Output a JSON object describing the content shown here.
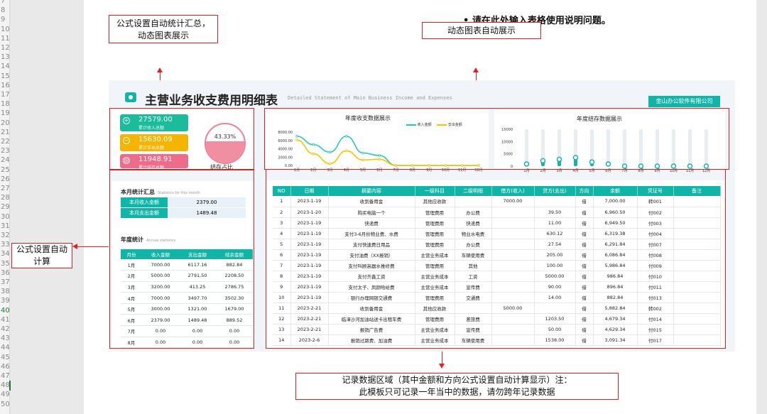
{
  "row_gutter": {
    "labels": [
      "7",
      "8",
      "9",
      "10",
      "11",
      "12",
      "13",
      "14",
      "15",
      "16",
      "17",
      "18",
      "19",
      "20",
      "21",
      "22",
      "23",
      "24",
      "25",
      "26",
      "27",
      "28",
      "29",
      "30",
      "31",
      "32",
      "33",
      "34",
      "35",
      "36",
      "37",
      "38",
      "39",
      "40",
      "41",
      "42",
      "43",
      "44",
      "45",
      "46",
      "47",
      "48",
      "49",
      "50"
    ],
    "active_label": "40"
  },
  "instruction_note": "•  请在此处输入表格使用说明问题。",
  "callouts": {
    "top_left": "公式设置自动统计汇总，动态图表展示",
    "top_right": "动态图表自动展示",
    "left": "公式设置自动计算",
    "bottom": "记录数据区域（其中金额和方向公式设置自动计算显示）注：此模板只可记录一年当中的数据，请勿跨年记录数据"
  },
  "dashboard": {
    "title": "主营业务收支费用明细表",
    "subtitle": "Detailed Statement of Main Business Income and Expenses",
    "company": "金山办公软件有限公司",
    "kpis": [
      {
        "value": "27579.00",
        "label": "累计收入总额",
        "color": "#1abc9c",
        "icon": "+"
      },
      {
        "value": "15630.09",
        "label": "累计支出总额",
        "color": "#f5b400",
        "icon": "−"
      },
      {
        "value": "11948.91",
        "label": "累计结存总额",
        "color": "#ee6c8a",
        "icon": "◎"
      }
    ],
    "balance_ratio": {
      "percent": "43.33%",
      "label": "结存占比",
      "fill_fraction": 0.55
    },
    "monthly": {
      "title": "本月统计汇总",
      "subtitle": "Statistics for this month",
      "rows": [
        {
          "key": "本月收入金额",
          "value": "2379.00"
        },
        {
          "key": "本月支出金额",
          "value": "1489.48"
        }
      ]
    },
    "annual": {
      "title": "年度统计",
      "subtitle": "Annual statistics",
      "headers": [
        "月份",
        "收入金额",
        "支出金额",
        "结余金额"
      ],
      "rows": [
        [
          "1月",
          "7000.00",
          "6117.16",
          "882.84"
        ],
        [
          "2月",
          "5000.00",
          "2791.50",
          "2208.50"
        ],
        [
          "3月",
          "3200.00",
          "413.25",
          "2786.75"
        ],
        [
          "4月",
          "7000.00",
          "3497.70",
          "3502.30"
        ],
        [
          "5月",
          "3000.00",
          "1321.00",
          "1679.00"
        ],
        [
          "6月",
          "2379.00",
          "1489.48",
          "889.52"
        ],
        [
          "7月",
          "0.00",
          "0.00",
          "0.00"
        ],
        [
          "8月",
          "0.00",
          "0.00",
          "0.00"
        ]
      ]
    },
    "detail_table": {
      "headers": [
        "NO",
        "日期",
        "摘要内容",
        "一级科目",
        "二级明细",
        "借方(收入)",
        "贷方(支出)",
        "方向",
        "余额",
        "凭证号",
        "备注"
      ],
      "rows": [
        [
          "1",
          "2023-1-19",
          "收到备用金",
          "其他应收款",
          "",
          "7000.00",
          "",
          "借",
          "7,000.00",
          "转001",
          ""
        ],
        [
          "2",
          "2023-1-20",
          "购买电脑一个",
          "管理费用",
          "办公费",
          "",
          "39.50",
          "借",
          "6,960.50",
          "付002",
          ""
        ],
        [
          "3",
          "2023-1-19",
          "快递费",
          "管理费用",
          "快递费",
          "",
          "11.00",
          "借",
          "6,949.50",
          "付003",
          ""
        ],
        [
          "4",
          "2023-1-19",
          "支付3-6月份物业费、水费",
          "管理费用",
          "物业水电费",
          "",
          "630.12",
          "借",
          "6,319.38",
          "付004",
          ""
        ],
        [
          "5",
          "2023-1-19",
          "支付快速费日用品",
          "管理费用",
          "办公费",
          "",
          "27.54",
          "借",
          "6,291.84",
          "付007",
          ""
        ],
        [
          "6",
          "2023-1-19",
          "支付油费（XX报销）",
          "主营业务成本",
          "车辆使用费",
          "",
          "205.00",
          "借",
          "6,086.84",
          "付008",
          ""
        ],
        [
          "7",
          "2023-1-19",
          "支付叫顾高器水推修费",
          "管理费用",
          "其他",
          "",
          "100.00",
          "借",
          "5,986.84",
          "付009",
          ""
        ],
        [
          "8",
          "2023-1-19",
          "支付齐鑫工资",
          "主营业务成本",
          "工资",
          "",
          "5000.00",
          "借",
          "986.84",
          "付010",
          ""
        ],
        [
          "9",
          "2023-1-19",
          "支付太子、凤颜哈给费",
          "主营业务成本",
          "宣传费",
          "",
          "90.00",
          "借",
          "896.84",
          "付011",
          ""
        ],
        [
          "10",
          "2023-1-19",
          "银行办理网银交通费",
          "管理费用",
          "交通费",
          "",
          "14.00",
          "借",
          "882.84",
          "付013",
          ""
        ],
        [
          "11",
          "2023-2-21",
          "收到备用金",
          "其他应收款",
          "",
          "5000.00",
          "",
          "借",
          "5,882.84",
          "转002",
          ""
        ],
        [
          "12",
          "2023-2-21",
          "临漳沙河加油站送卡出租车费",
          "管理费用",
          "差旅费",
          "",
          "1203.50",
          "借",
          "4,679.34",
          "付014",
          ""
        ],
        [
          "13",
          "2023-2-21",
          "报销广告费",
          "主营业务成本",
          "宣传费",
          "",
          "50.00",
          "借",
          "4,629.34",
          "付015",
          ""
        ],
        [
          "14",
          "2023-2-6",
          "报销过路费、加油费",
          "主营业务成本",
          "车辆使用费",
          "",
          "1538.00",
          "借",
          "3,091.34",
          "付017",
          ""
        ]
      ]
    }
  },
  "chart_data": [
    {
      "type": "line",
      "title": "年度收支数据展示",
      "categories": [
        "1月",
        "2月",
        "3月",
        "4月",
        "5月",
        "6月",
        "7月",
        "8月",
        "9月",
        "10月",
        "11月",
        "12月"
      ],
      "series": [
        {
          "name": "收入金额",
          "color": "#2ec4b6",
          "values": [
            7000,
            5000,
            3200,
            7000,
            3000,
            2379,
            0,
            0,
            0,
            0,
            0,
            0
          ]
        },
        {
          "name": "支出金额",
          "color": "#f5c400",
          "values": [
            6117.16,
            2791.5,
            413.25,
            3497.7,
            1321,
            1489.48,
            0,
            0,
            0,
            0,
            0,
            0
          ]
        }
      ],
      "yticks": [
        "8000.00",
        "6000.00",
        "4000.00",
        "2000.00",
        "0.00"
      ],
      "ylim": [
        0,
        8000
      ]
    },
    {
      "type": "bar",
      "title": "年度结存数据展示",
      "categories": [
        "1月",
        "2月",
        "3月",
        "4月",
        "5月",
        "6月",
        "7月",
        "8月",
        "9月",
        "10月",
        "11月",
        "12月"
      ],
      "values": [
        882.84,
        2208.5,
        2786.75,
        3502.3,
        1679,
        889.52,
        0,
        0,
        0,
        0,
        0,
        0
      ],
      "color": "#19b3a6",
      "yticks": [
        "15000",
        "10000",
        "5000",
        "0"
      ],
      "ylim": [
        0,
        15000
      ]
    }
  ]
}
